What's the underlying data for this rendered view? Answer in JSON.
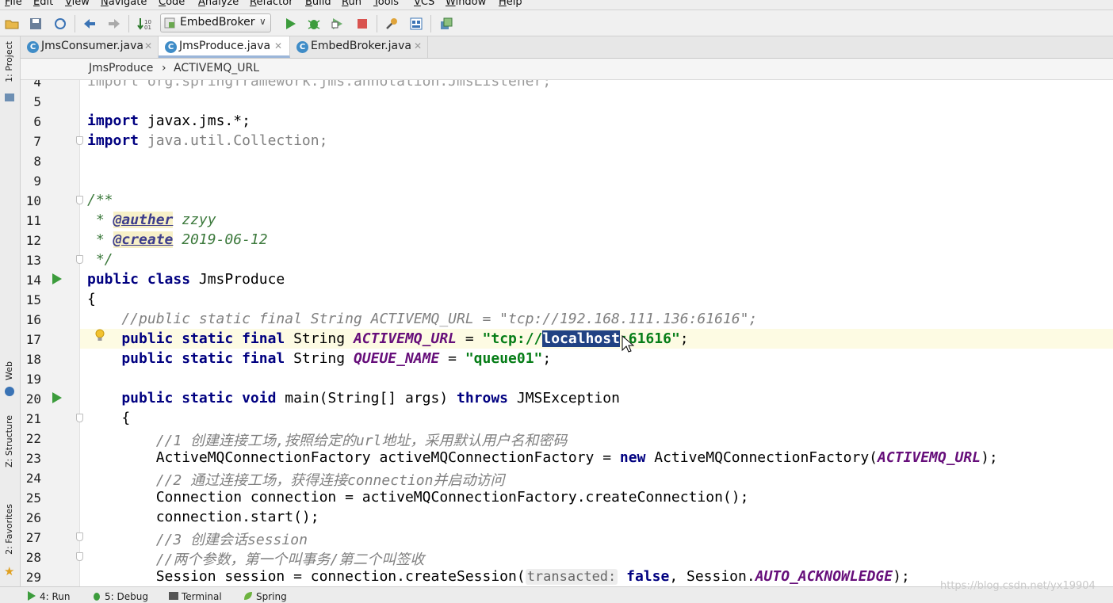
{
  "menu": [
    "File",
    "Edit",
    "View",
    "Navigate",
    "Code",
    "Analyze",
    "Refactor",
    "Build",
    "Run",
    "Tools",
    "VCS",
    "Window",
    "Help"
  ],
  "toolbar": {
    "run_config": "EmbedBroker",
    "icons": [
      "open-icon",
      "save-icon",
      "sync-icon",
      "back-icon",
      "forward-icon",
      "build-icon",
      "run-icon",
      "debug-icon",
      "coverage-icon",
      "stop-icon",
      "project-structure-icon",
      "sdk-icon",
      "vcs-icon"
    ]
  },
  "tabs": [
    {
      "label": "JmsConsumer.java",
      "active": false
    },
    {
      "label": "JmsProduce.java",
      "active": true
    },
    {
      "label": "EmbedBroker.java",
      "active": false
    }
  ],
  "breadcrumb": {
    "class": "JmsProduce",
    "separator": "›",
    "field": "ACTIVEMQ_URL"
  },
  "left_tools": [
    "1: Project",
    "Web",
    "Z: Structure",
    "2: Favorites"
  ],
  "editor": {
    "line_numbers": [
      "4",
      "5",
      "6",
      "7",
      "8",
      "9",
      "10",
      "11",
      "12",
      "13",
      "14",
      "15",
      "16",
      "17",
      "18",
      "19",
      "20",
      "21",
      "22",
      "23",
      "24",
      "25",
      "26",
      "27",
      "28",
      "29"
    ],
    "code": {
      "l4": "import org.springframework.jms.annotation.JmsListener;",
      "l6_kw": "import",
      "l6_rest": " javax.jms.*;",
      "l7_kw": "import",
      "l7_rest": " java.util.Collection;",
      "l10": "/**",
      "l11_star": " * ",
      "l11_tag": "@auther",
      "l11_val": " zzyy",
      "l12_star": " * ",
      "l12_tag": "@create",
      "l12_val": " 2019-06-12",
      "l13": " */",
      "l14_kw": "public class",
      "l14_rest": " JmsProduce",
      "l15": "{",
      "l16": "    //public static final String ACTIVEMQ_URL = \"tcp://192.168.111.136:61616\";",
      "l17_kw": "    public static final",
      "l17_type": " String ",
      "l17_field": "ACTIVEMQ_URL",
      "l17_eq": " = ",
      "l17_str_a": "\"tcp://",
      "l17_sel": "localhost",
      "l17_str_b": ":61616\"",
      "l17_end": ";",
      "l18_kw": "    public static final",
      "l18_type": " String ",
      "l18_field": "QUEUE_NAME",
      "l18_eq": " = ",
      "l18_str": "\"queue01\"",
      "l18_end": ";",
      "l20_kw": "    public static void",
      "l20_mid": " main(String[] args) ",
      "l20_kw2": "throws",
      "l20_rest": " JMSException",
      "l21": "    {",
      "l22": "        //1 创建连接工场,按照给定的url地址，采用默认用户名和密码",
      "l23_a": "        ActiveMQConnectionFactory activeMQConnectionFactory = ",
      "l23_kw": "new",
      "l23_b": " ActiveMQConnectionFactory(",
      "l23_field": "ACTIVEMQ_URL",
      "l23_c": ");",
      "l24": "        //2 通过连接工场，获得连接connection并启动访问",
      "l25": "        Connection connection = activeMQConnectionFactory.createConnection();",
      "l26": "        connection.start();",
      "l27": "        //3 创建会话session",
      "l28": "        //两个参数，第一个叫事务/第二个叫签收",
      "l29_a": "        Session session = connection.createSession(",
      "l29_hint": "transacted:",
      "l29_kw": "false",
      "l29_b": ", Session.",
      "l29_field": "AUTO_ACKNOWLEDGE",
      "l29_c": ");"
    }
  },
  "bottom_tools": [
    "4: Run",
    "5: Debug",
    "Terminal",
    "Spring"
  ],
  "watermark": "https://blog.csdn.net/yx19904",
  "colors": {
    "keyword": "#000080",
    "string": "#067d17",
    "static_field": "#660e7a",
    "comment": "#808080",
    "selection": "#214283",
    "current_line": "#fdfbe3"
  }
}
